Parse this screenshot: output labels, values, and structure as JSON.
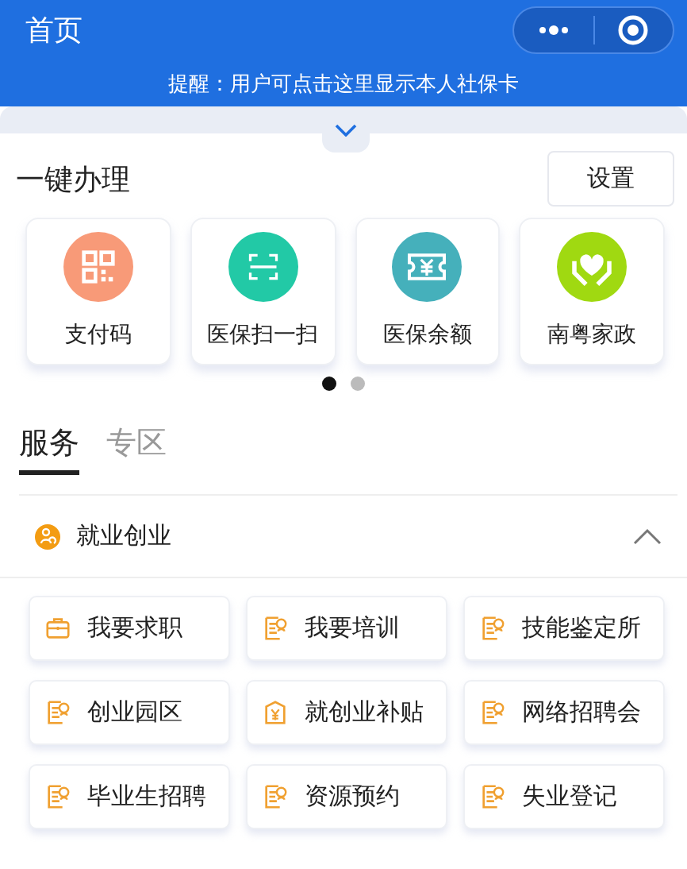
{
  "nav_bar": {
    "title": "首页"
  },
  "notice": "提醒：用户可点击这里显示本人社保卡",
  "quick_actions": {
    "title": "一键办理",
    "settings_button": "设置",
    "items": [
      {
        "label": "支付码",
        "kind": "qr",
        "color": "#f89a78"
      },
      {
        "label": "医保扫一扫",
        "kind": "scan",
        "color": "#22c9a6"
      },
      {
        "label": "医保余额",
        "kind": "money",
        "color": "#45b0bb"
      },
      {
        "label": "南粤家政",
        "kind": "care",
        "color": "#a0d911"
      }
    ],
    "pages": [
      {
        "selected": true
      },
      {
        "selected": false
      }
    ]
  },
  "tabs": [
    {
      "label": "服务",
      "selected": true
    },
    {
      "label": "专区",
      "selected": false
    }
  ],
  "category": {
    "title": "就业创业",
    "expanded": true,
    "items": [
      {
        "label": "我要求职",
        "kind": "briefcase"
      },
      {
        "label": "我要培训",
        "kind": "form"
      },
      {
        "label": "技能鉴定所",
        "kind": "form"
      },
      {
        "label": "创业园区",
        "kind": "form"
      },
      {
        "label": "就创业补贴",
        "kind": "subsidy"
      },
      {
        "label": "网络招聘会",
        "kind": "form"
      },
      {
        "label": "毕业生招聘",
        "kind": "form"
      },
      {
        "label": "资源预约",
        "kind": "form"
      },
      {
        "label": "失业登记",
        "kind": "form"
      }
    ]
  }
}
